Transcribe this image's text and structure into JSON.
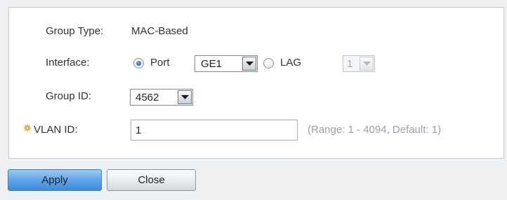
{
  "form": {
    "group_type": {
      "label": "Group Type:",
      "value": "MAC-Based"
    },
    "interface": {
      "label": "Interface:",
      "port_label": "Port",
      "port_selected": true,
      "port_value": "GE1",
      "lag_label": "LAG",
      "lag_selected": false,
      "lag_value": "1"
    },
    "group_id": {
      "label": "Group ID:",
      "value": "4562"
    },
    "vlan_id": {
      "label": "VLAN ID:",
      "value": "1",
      "hint": "(Range: 1 - 4094, Default: 1)",
      "required": true
    }
  },
  "buttons": {
    "apply": "Apply",
    "close": "Close"
  },
  "colors": {
    "required_icon": "#e8a33c",
    "apply_button": "#5aa3e6",
    "hint_text": "#9aa1a8"
  },
  "icons": {
    "required": "required-gear-icon",
    "dropdown": "chevron-down-icon"
  }
}
